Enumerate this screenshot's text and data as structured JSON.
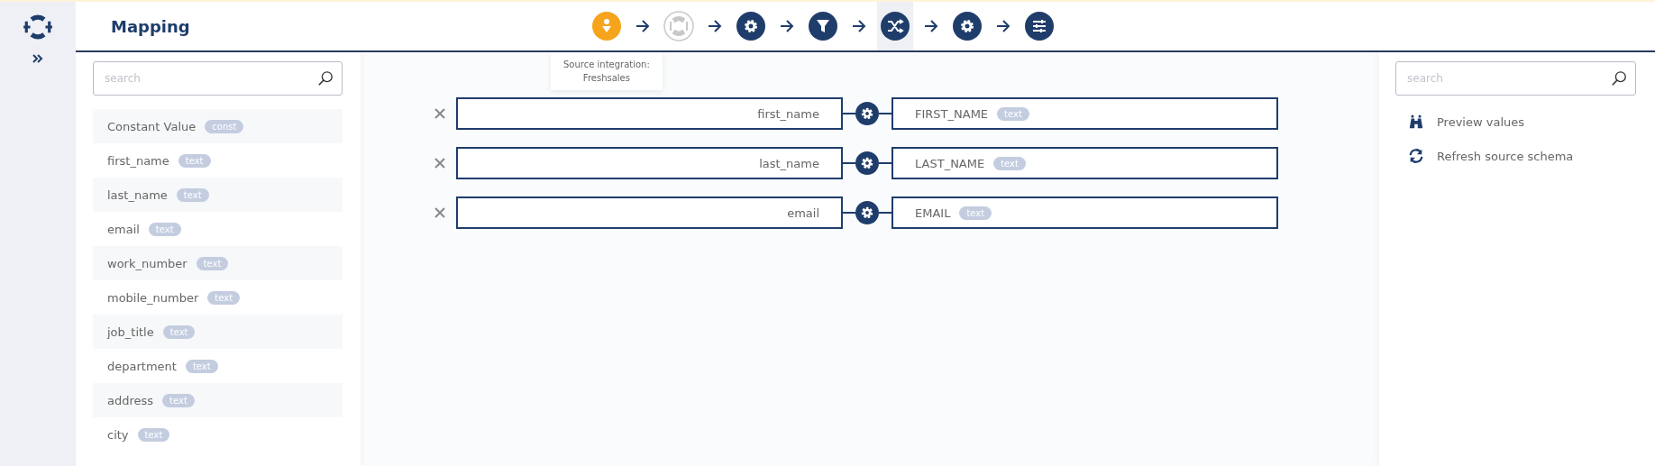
{
  "header": {
    "title": "Mapping"
  },
  "steps": [
    {
      "kind": "source",
      "color": "#f5a41c",
      "selected": false
    },
    {
      "kind": "logo",
      "color": "#c8c8c8",
      "selected": false
    },
    {
      "kind": "gear",
      "color": "#1f3d6b",
      "selected": false
    },
    {
      "kind": "filter",
      "color": "#1f3d6b",
      "selected": false
    },
    {
      "kind": "shuffle",
      "color": "#1f3d6b",
      "selected": true
    },
    {
      "kind": "gear",
      "color": "#1f3d6b",
      "selected": false
    },
    {
      "kind": "sliders",
      "color": "#1f3d6b",
      "selected": false
    }
  ],
  "tooltip": {
    "lines": [
      "Source integration:",
      "Freshsales"
    ]
  },
  "source_panel": {
    "search": {
      "placeholder": "search"
    },
    "fields": [
      {
        "name": "Constant Value",
        "type": "const"
      },
      {
        "name": "first_name",
        "type": "text"
      },
      {
        "name": "last_name",
        "type": "text"
      },
      {
        "name": "email",
        "type": "text"
      },
      {
        "name": "work_number",
        "type": "text"
      },
      {
        "name": "mobile_number",
        "type": "text"
      },
      {
        "name": "job_title",
        "type": "text"
      },
      {
        "name": "department",
        "type": "text"
      },
      {
        "name": "address",
        "type": "text"
      },
      {
        "name": "city",
        "type": "text"
      }
    ]
  },
  "mappings": [
    {
      "source": "first_name",
      "target": "FIRST_NAME",
      "type": "text"
    },
    {
      "source": "last_name",
      "target": "LAST_NAME",
      "type": "text"
    },
    {
      "source": "email",
      "target": "EMAIL",
      "type": "text"
    }
  ],
  "actions_panel": {
    "search": {
      "placeholder": "search"
    },
    "actions": [
      {
        "kind": "binoculars",
        "label": "Preview values"
      },
      {
        "kind": "refresh",
        "label": "Refresh source schema"
      }
    ]
  }
}
